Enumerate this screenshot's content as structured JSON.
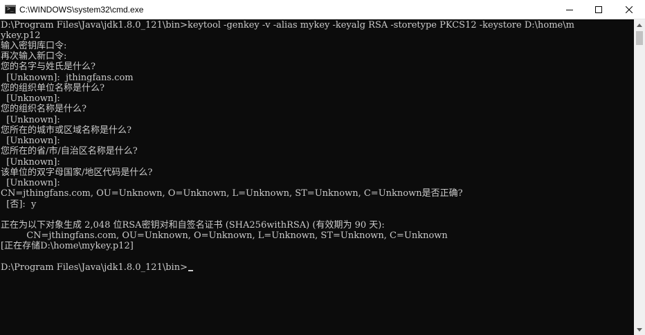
{
  "window": {
    "title": "C:\\WINDOWS\\system32\\cmd.exe",
    "icon": "cmd-icon",
    "controls": {
      "minimize": "minimize-icon",
      "maximize": "maximize-icon",
      "close": "close-icon"
    }
  },
  "console": {
    "lines": [
      "D:\\Program Files\\Java\\jdk1.8.0_121\\bin>keytool -genkey -v -alias mykey -keyalg RSA -storetype PKCS12 -keystore D:\\home\\m",
      "ykey.p12",
      "输入密钥库口令:",
      "再次输入新口令:",
      "您的名字与姓氏是什么?",
      "  [Unknown]:  jthingfans.com",
      "您的组织单位名称是什么?",
      "  [Unknown]:",
      "您的组织名称是什么?",
      "  [Unknown]:",
      "您所在的城市或区域名称是什么?",
      "  [Unknown]:",
      "您所在的省/市/自治区名称是什么?",
      "  [Unknown]:",
      "该单位的双字母国家/地区代码是什么?",
      "  [Unknown]:",
      "CN=jthingfans.com, OU=Unknown, O=Unknown, L=Unknown, ST=Unknown, C=Unknown是否正确?",
      "  [否]:  y",
      "",
      "正在为以下对象生成 2,048 位RSA密钥对和自签名证书 (SHA256withRSA) (有效期为 90 天):",
      "         CN=jthingfans.com, OU=Unknown, O=Unknown, L=Unknown, ST=Unknown, C=Unknown",
      "[正在存储D:\\home\\mykey.p12]",
      "",
      "D:\\Program Files\\Java\\jdk1.8.0_121\\bin>"
    ]
  },
  "scrollbar": {
    "up": "scroll-up-arrow-icon",
    "down": "scroll-down-arrow-icon"
  }
}
